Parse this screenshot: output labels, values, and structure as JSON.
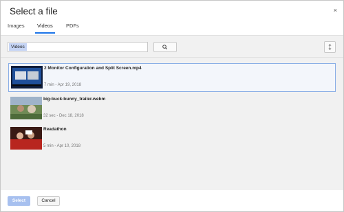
{
  "dialog": {
    "title": "Select a file",
    "close_label": "×"
  },
  "tabs": [
    {
      "label": "Images",
      "active": false
    },
    {
      "label": "Videos",
      "active": true
    },
    {
      "label": "PDFs",
      "active": false
    }
  ],
  "search": {
    "chip": "Videos",
    "value": ""
  },
  "colors": {
    "accent": "#1a73e8",
    "selected_border": "#89aee6"
  },
  "items": [
    {
      "title": "2 Monitor Configuration and Split Screen.mp4",
      "meta": "7 min - Apr 19, 2018",
      "selected": true
    },
    {
      "title": "big-buck-bunny_trailer.webm",
      "meta": "32 sec - Dec 18, 2018",
      "selected": false
    },
    {
      "title": "Readathon",
      "meta": "5 min - Apr 10, 2018",
      "selected": false
    }
  ],
  "footer": {
    "select_label": "Select",
    "cancel_label": "Cancel"
  }
}
